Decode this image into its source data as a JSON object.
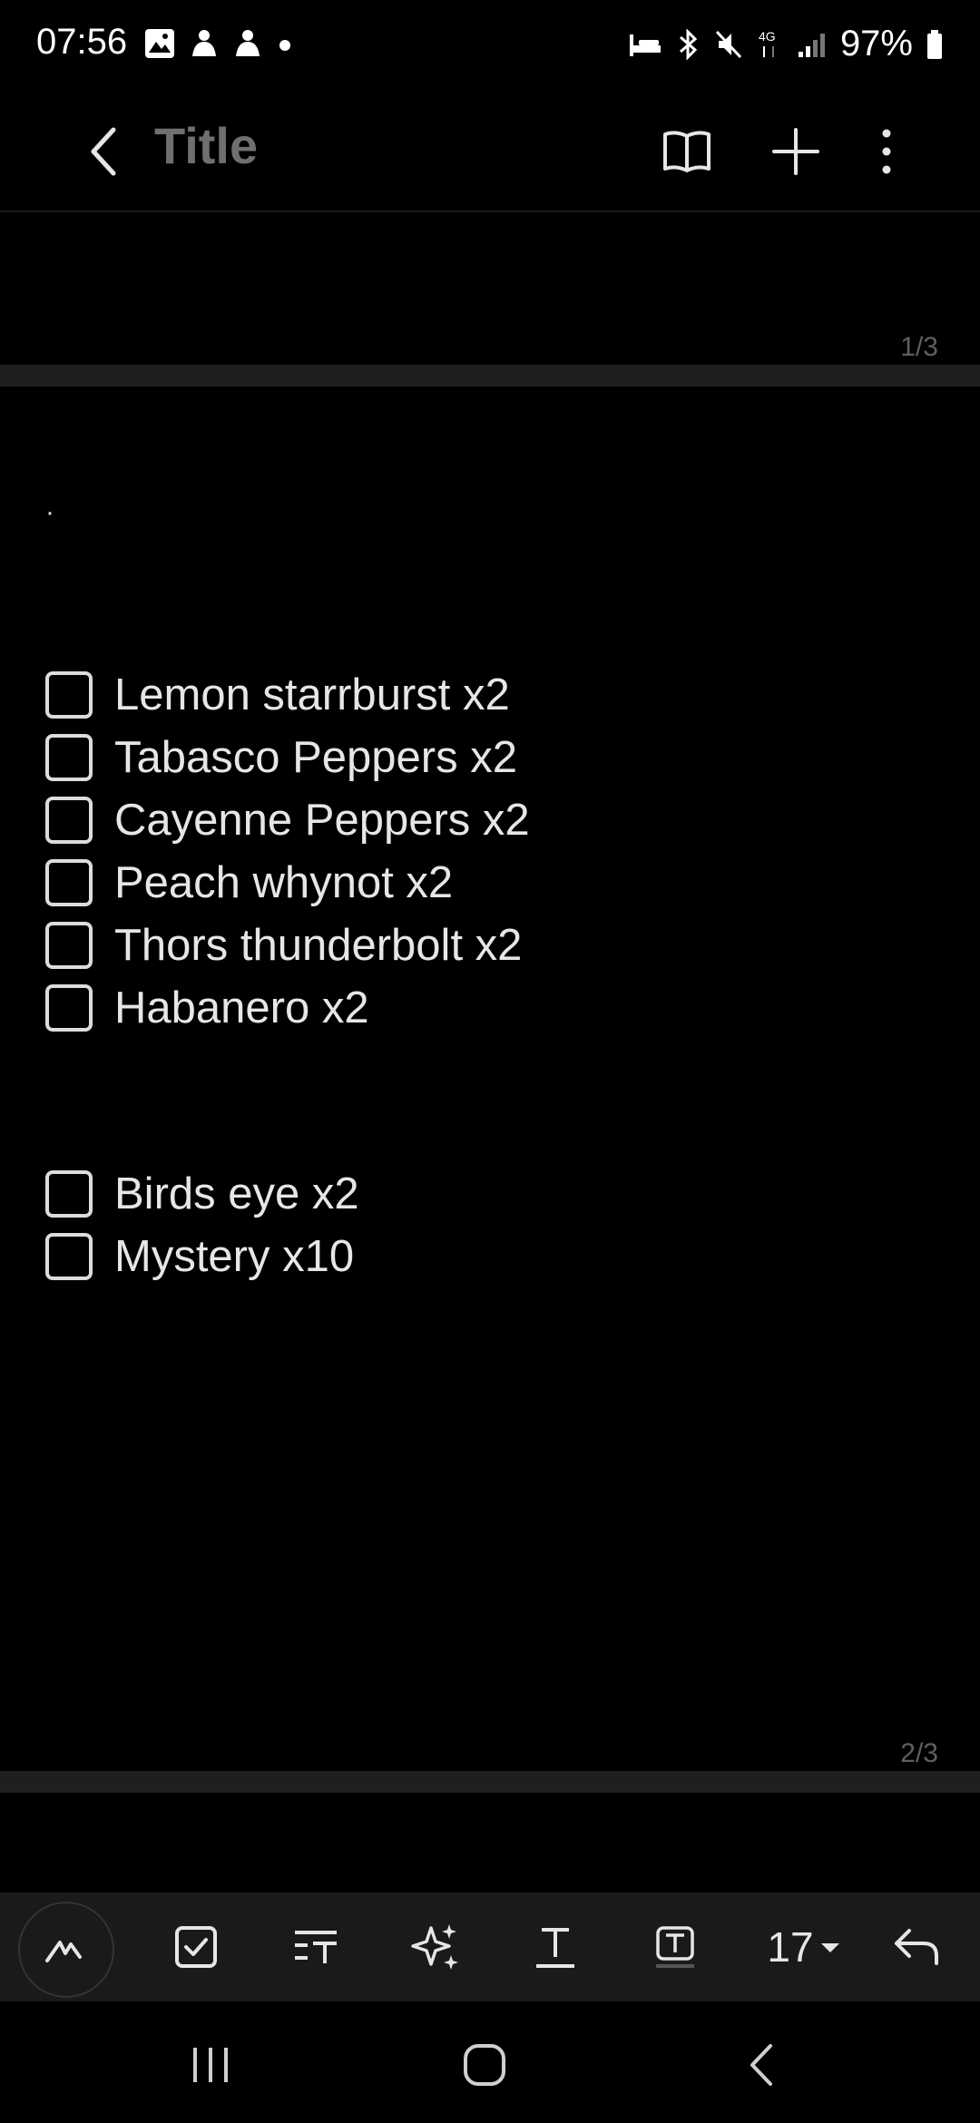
{
  "status_bar": {
    "time": "07:56",
    "battery_text": "97%",
    "icons_left": [
      "gallery-icon",
      "app-icon",
      "app-icon",
      "dot-icon"
    ],
    "icons_right": [
      "bed-icon",
      "bluetooth-icon",
      "mute-icon",
      "network-4g-icon",
      "signal-icon",
      "battery-icon"
    ]
  },
  "header": {
    "title": "Title",
    "icons": [
      "back-icon",
      "book-icon",
      "plus-icon",
      "more-icon"
    ]
  },
  "pages": {
    "page1_label": "1/3",
    "page2_label": "2/3"
  },
  "note": {
    "stray_mark": "·",
    "group1": [
      {
        "label": "Lemon starrburst x2",
        "checked": false
      },
      {
        "label": "Tabasco Peppers x2",
        "checked": false
      },
      {
        "label": "Cayenne Peppers x2",
        "checked": false
      },
      {
        "label": "Peach whynot x2",
        "checked": false
      },
      {
        "label": "Thors thunderbolt x2",
        "checked": false
      },
      {
        "label": "Habanero x2",
        "checked": false
      }
    ],
    "group2": [
      {
        "label": "Birds eye x2",
        "checked": false
      },
      {
        "label": "Mystery x10",
        "checked": false
      }
    ]
  },
  "toolbar": {
    "font_size": "17",
    "icons": [
      "pen-icon",
      "checkbox-icon",
      "text-format-icon",
      "ai-sparkle-icon",
      "text-style-icon",
      "text-box-icon",
      "size-dropdown-icon",
      "undo-icon"
    ]
  },
  "navbar": {
    "icons": [
      "recents-icon",
      "home-icon",
      "back-nav-icon"
    ]
  }
}
